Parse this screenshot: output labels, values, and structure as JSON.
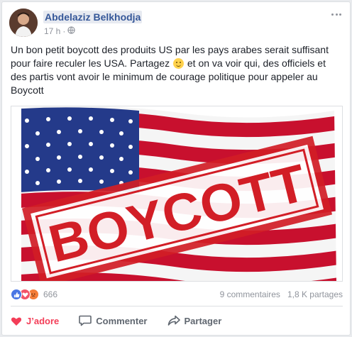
{
  "post": {
    "author": "Abdelaziz Belkhodja",
    "time": "17 h",
    "separator": "·",
    "text_before_emoji": "Un bon petit boycott des produits US par les pays arabes serait suffisant pour faire reculer les USA. Partagez ",
    "text_after_emoji": " et on va voir qui, des officiels et des partis vont avoir le minimum de courage politique pour appeler au Boycott",
    "image_stamp_text": "BOYCOTT"
  },
  "reactions": {
    "count": "666",
    "comments": "9 commentaires",
    "shares": "1,8 K partages",
    "icons": [
      "like-icon",
      "love-icon",
      "angry-icon"
    ]
  },
  "actions": {
    "love_label": "J’adore",
    "comment_label": "Commenter",
    "share_label": "Partager"
  },
  "colors": {
    "author_link": "#365899",
    "meta_gray": "#90949c",
    "love_red": "#f33e58",
    "stamp_red": "#d21e26",
    "flag_blue": "#2a3b8a"
  }
}
